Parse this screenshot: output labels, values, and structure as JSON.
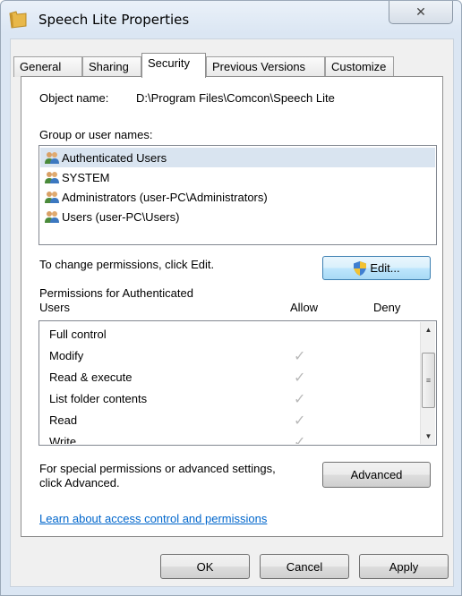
{
  "window": {
    "title": "Speech Lite Properties",
    "close_glyph": "✕"
  },
  "tabs": [
    {
      "label": "General",
      "active": false
    },
    {
      "label": "Sharing",
      "active": false
    },
    {
      "label": "Security",
      "active": true
    },
    {
      "label": "Previous Versions",
      "active": false
    },
    {
      "label": "Customize",
      "active": false
    }
  ],
  "security": {
    "object_name_label": "Object name:",
    "object_name_value": "D:\\Program Files\\Comcon\\Speech Lite",
    "group_label": "Group or user names:",
    "groups": [
      {
        "label": "Authenticated Users",
        "selected": true
      },
      {
        "label": "SYSTEM",
        "selected": false
      },
      {
        "label": "Administrators (user-PC\\Administrators)",
        "selected": false
      },
      {
        "label": "Users (user-PC\\Users)",
        "selected": false
      }
    ],
    "change_hint": "To change permissions, click Edit.",
    "edit_label": "Edit...",
    "permissions_for_line1": "Permissions for Authenticated",
    "permissions_for_line2": "Users",
    "allow_header": "Allow",
    "deny_header": "Deny",
    "permissions": [
      {
        "label": "Full control",
        "allow": false,
        "deny": false
      },
      {
        "label": "Modify",
        "allow": true,
        "deny": false
      },
      {
        "label": "Read & execute",
        "allow": true,
        "deny": false
      },
      {
        "label": "List folder contents",
        "allow": true,
        "deny": false
      },
      {
        "label": "Read",
        "allow": true,
        "deny": false
      },
      {
        "label": "Write",
        "allow": true,
        "deny": false
      }
    ],
    "check_glyph": "✓",
    "special_line1": "For special permissions or advanced settings,",
    "special_line2": "click Advanced.",
    "advanced_label": "Advanced",
    "learn_link": "Learn about access control and permissions"
  },
  "footer": {
    "ok_label": "OK",
    "cancel_label": "Cancel",
    "apply_label": "Apply"
  },
  "colors": {
    "selection": "#d9e4f0",
    "link": "#0066cc",
    "check": "#b9b9b9"
  }
}
